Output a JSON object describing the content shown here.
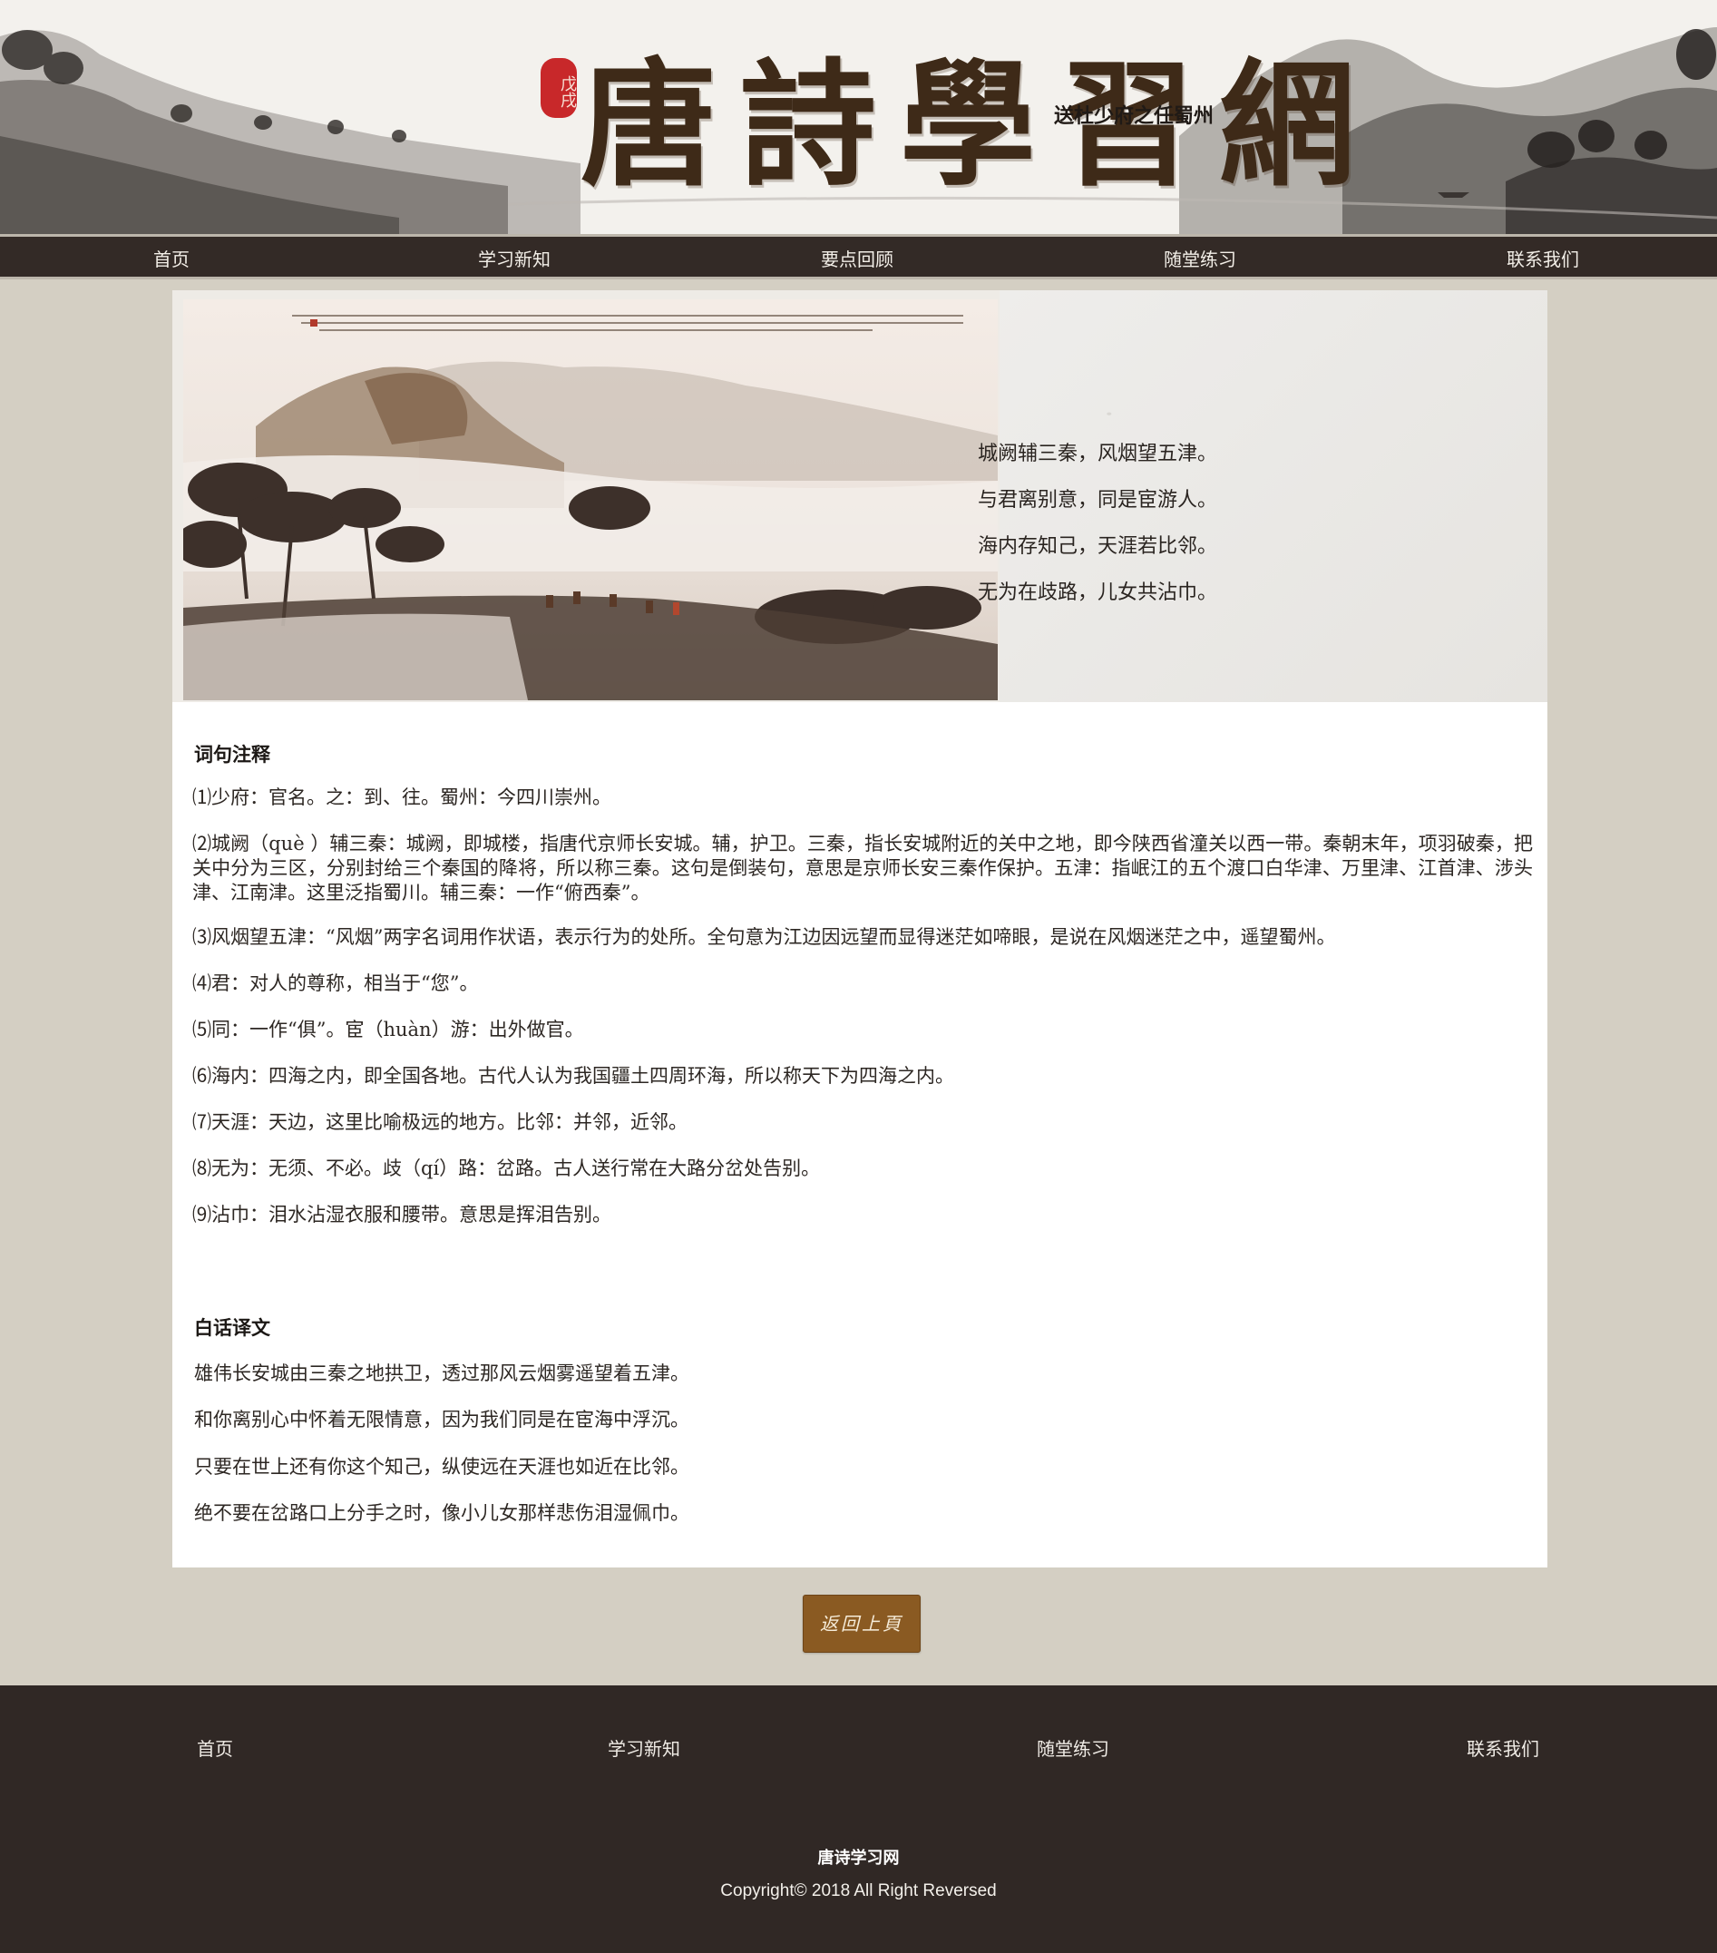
{
  "header": {
    "seal_text": "戊戌",
    "site_logo": "唐詩學習網"
  },
  "nav": {
    "items": [
      "首页",
      "学习新知",
      "要点回顾",
      "随堂练习",
      "联系我们"
    ]
  },
  "poem": {
    "title": "送杜少府之任蜀州",
    "lines": [
      "城阙辅三秦，风烟望五津。",
      "与君离别意，同是宦游人。",
      "海内存知己，天涯若比邻。",
      "无为在歧路，儿女共沾巾。"
    ]
  },
  "notes": {
    "heading": "词句注释",
    "items": [
      "⑴少府：官名。之：到、往。蜀州：今四川崇州。",
      "⑵城阙（què ）辅三秦：城阙，即城楼，指唐代京师长安城。辅，护卫。三秦，指长安城附近的关中之地，即今陕西省潼关以西一带。秦朝末年，项羽破秦，把关中分为三区，分别封给三个秦国的降将，所以称三秦。这句是倒装句，意思是京师长安三秦作保护。五津：指岷江的五个渡口白华津、万里津、江首津、涉头津、江南津。这里泛指蜀川。辅三秦：一作“俯西秦”。",
      "⑶风烟望五津：“风烟”两字名词用作状语，表示行为的处所。全句意为江边因远望而显得迷茫如啼眼，是说在风烟迷茫之中，遥望蜀州。",
      "⑷君：对人的尊称，相当于“您”。",
      "⑸同：一作“俱”。宦（huàn）游：出外做官。",
      "⑹海内：四海之内，即全国各地。古代人认为我国疆土四周环海，所以称天下为四海之内。",
      "⑺天涯：天边，这里比喻极远的地方。比邻：并邻，近邻。",
      "⑻无为：无须、不必。歧（qí）路：岔路。古人送行常在大路分岔处告别。",
      "⑼沾巾：泪水沾湿衣服和腰带。意思是挥泪告别。"
    ]
  },
  "translation": {
    "heading": "白话译文",
    "lines": [
      "雄伟长安城由三秦之地拱卫，透过那风云烟雾遥望着五津。",
      "和你离别心中怀着无限情意，因为我们同是在宦海中浮沉。",
      "只要在世上还有你这个知己，纵使远在天涯也如近在比邻。",
      "绝不要在岔路口上分手之时，像小儿女那样悲伤泪湿佩巾。"
    ]
  },
  "back_button": {
    "label": "返回上頁"
  },
  "footer": {
    "links": [
      "首页",
      "学习新知",
      "随堂练习",
      "联系我们"
    ],
    "site_name": "唐诗学习网",
    "copyright": "Copyright© 2018 All Right Reversed"
  },
  "colors": {
    "page_bg": "#d4cfc3",
    "nav_bg": "#332a26",
    "footer_bg": "#302825",
    "button_bg": "#8a5a22",
    "seal_red": "#c8282a"
  }
}
